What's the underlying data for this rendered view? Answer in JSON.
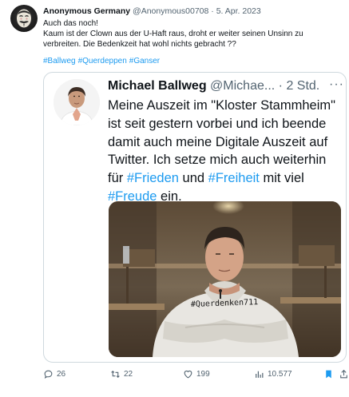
{
  "tweet": {
    "author_name": "Anonymous Germany",
    "author_handle": "@Anonymous00708",
    "separator": "·",
    "date": "5. Apr. 2023",
    "text_lines": [
      "Auch das noch!",
      "Kaum ist der Clown aus der U-Haft raus, droht er weiter seinen Unsinn zu",
      "verbreiten. Die Bedenkzeit hat wohl nichts gebracht ??"
    ],
    "hashtags": [
      "#Ballweg",
      "#Querdeppen",
      "#Ganser"
    ]
  },
  "quote": {
    "author_name": "Michael Ballweg",
    "author_handle": "@Michae...",
    "separator": "·",
    "time": "2 Std.",
    "more": "···",
    "line1": "Meine Auszeit im \"Kloster Stammheim\"",
    "line2": "ist seit gestern vorbei und ich beende",
    "line3": "damit auch meine Digitale Auszeit auf",
    "line4": "Twitter. Ich setze mich auch weiterhin",
    "line5_pre": "für ",
    "tag_frieden": "#Frieden",
    "line5_mid": " und ",
    "tag_freiheit": "#Freiheit",
    "line5_post": " mit viel",
    "tag_freude": "#Freude",
    "line6_post": " ein.",
    "shirt_text": "#Querdenken711"
  },
  "actions": {
    "replies": "26",
    "retweets": "22",
    "likes": "199",
    "views": "10.577"
  },
  "colors": {
    "link": "#1d9bf0",
    "muted": "#536471",
    "text": "#0f1419",
    "bookmark": "#1d9bf0"
  }
}
